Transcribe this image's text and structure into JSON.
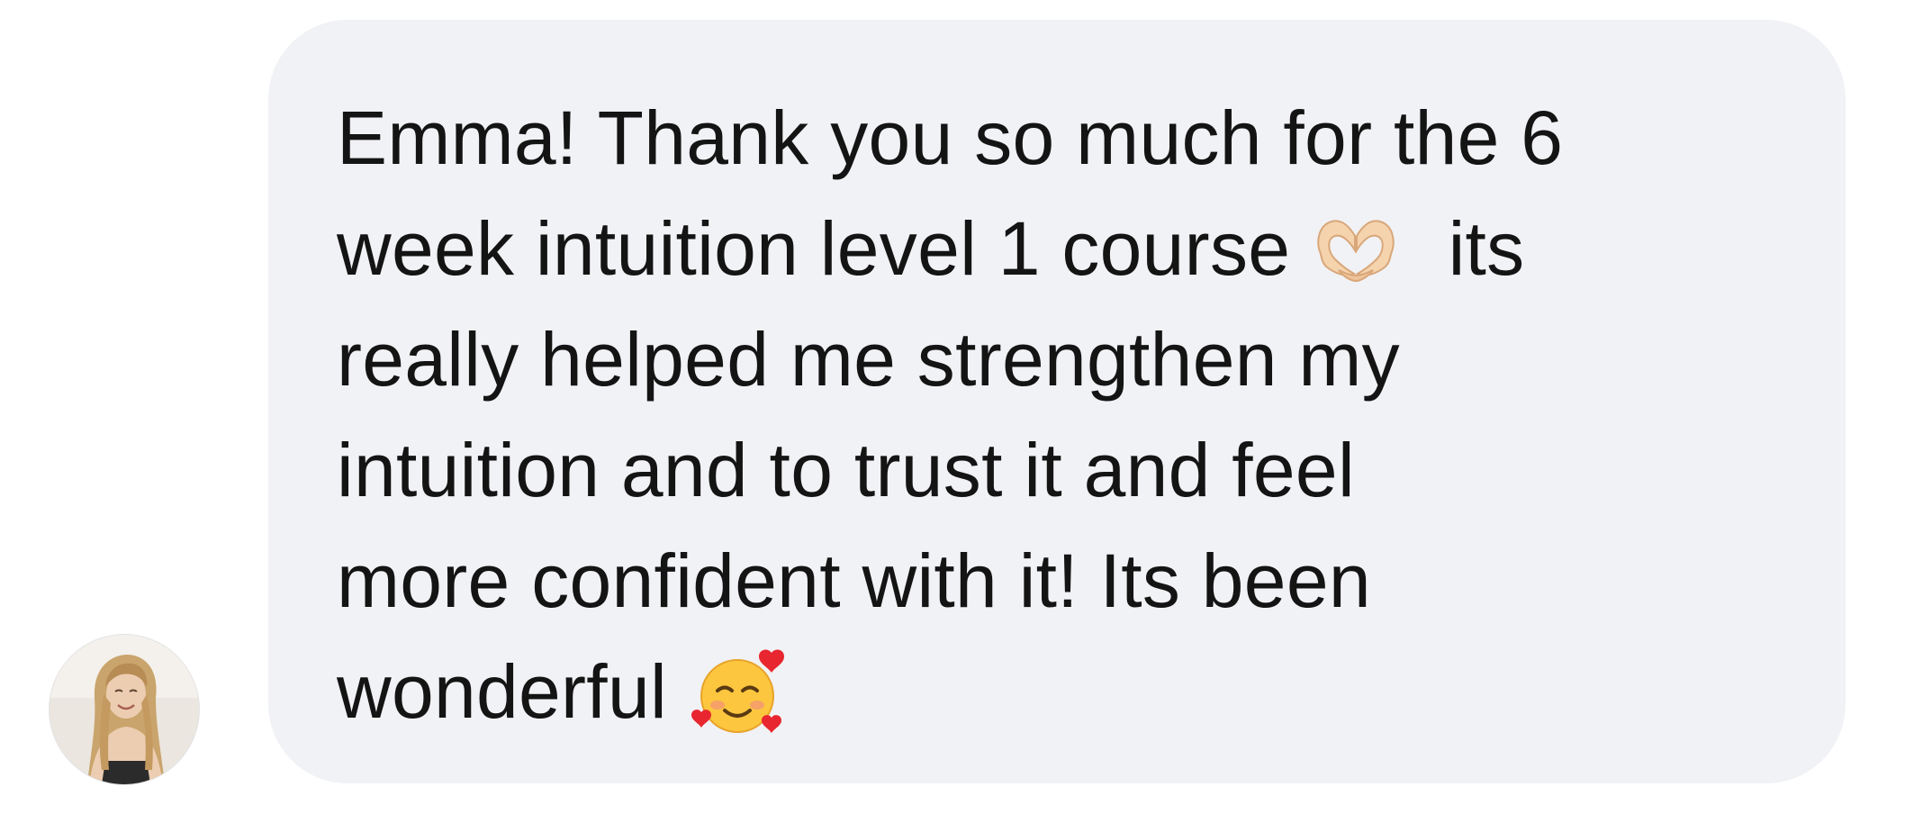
{
  "message": {
    "lines": [
      "Emma! Thank you so much for the 6",
      "week intuition level 1 course",
      "its",
      "really helped me strengthen my",
      "intuition and to trust it and feel",
      "more confident with it! Its been",
      "wonderful"
    ],
    "emoji_heart_hands": "heart-hands",
    "emoji_smiling_hearts": "smiling-face-with-hearts"
  },
  "colors": {
    "bubble_background": "#f1f2f5",
    "text": "#141414",
    "page_background": "#ffffff"
  }
}
